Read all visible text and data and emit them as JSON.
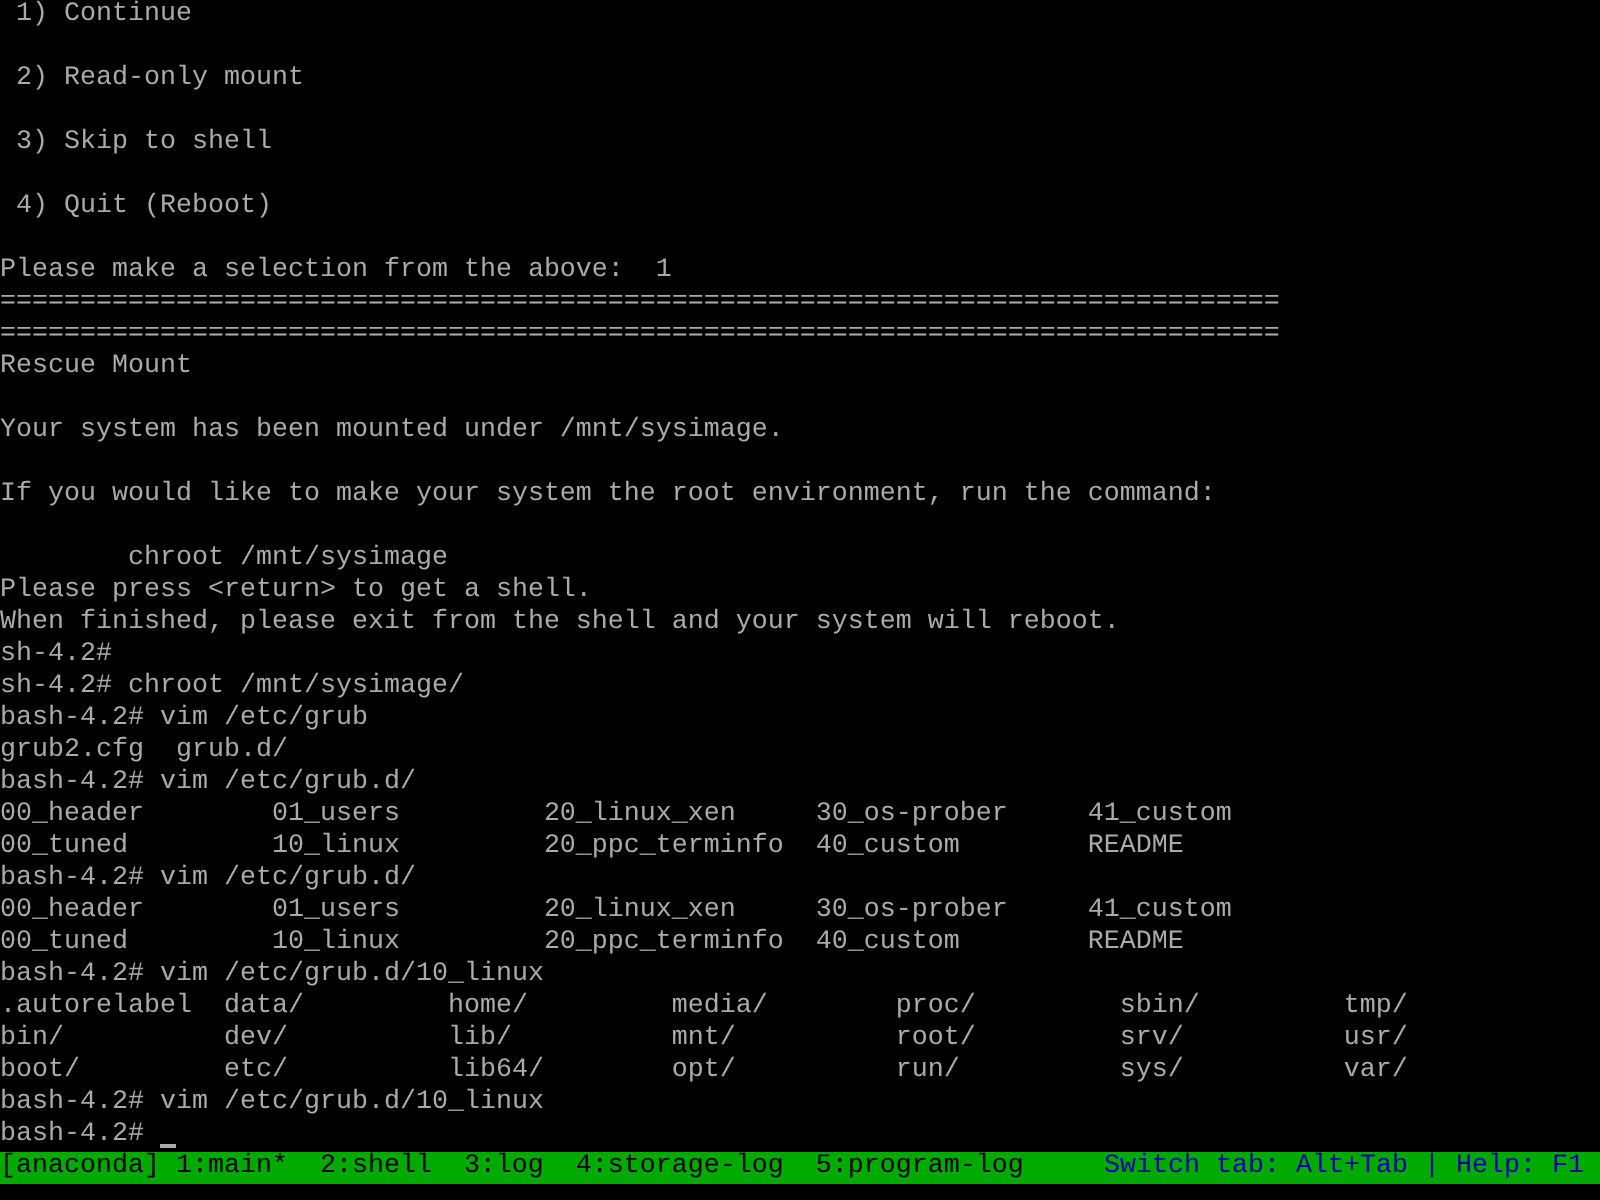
{
  "terminal": {
    "lines": [
      {
        "kind": "text",
        "text": " 1) Continue"
      },
      {
        "kind": "blank"
      },
      {
        "kind": "text",
        "text": " 2) Read-only mount"
      },
      {
        "kind": "blank"
      },
      {
        "kind": "text",
        "text": " 3) Skip to shell"
      },
      {
        "kind": "blank"
      },
      {
        "kind": "text",
        "text": " 4) Quit (Reboot)"
      },
      {
        "kind": "blank"
      },
      {
        "kind": "text",
        "text": "Please make a selection from the above:  1"
      },
      {
        "kind": "text",
        "text": "================================================================================"
      },
      {
        "kind": "text",
        "text": "================================================================================"
      },
      {
        "kind": "text",
        "text": "Rescue Mount"
      },
      {
        "kind": "blank"
      },
      {
        "kind": "text",
        "text": "Your system has been mounted under /mnt/sysimage."
      },
      {
        "kind": "blank"
      },
      {
        "kind": "text",
        "text": "If you would like to make your system the root environment, run the command:"
      },
      {
        "kind": "blank"
      },
      {
        "kind": "text",
        "text": "        chroot /mnt/sysimage"
      },
      {
        "kind": "text",
        "text": "Please press <return> to get a shell."
      },
      {
        "kind": "text",
        "text": "When finished, please exit from the shell and your system will reboot."
      },
      {
        "kind": "text",
        "text": "sh-4.2#"
      },
      {
        "kind": "text",
        "text": "sh-4.2# chroot /mnt/sysimage/"
      },
      {
        "kind": "text",
        "text": "bash-4.2# vim /etc/grub"
      },
      {
        "kind": "text",
        "text": "grub2.cfg  grub.d/"
      },
      {
        "kind": "text",
        "text": "bash-4.2# vim /etc/grub.d/"
      },
      {
        "kind": "text",
        "text": "00_header        01_users         20_linux_xen     30_os-prober     41_custom"
      },
      {
        "kind": "text",
        "text": "00_tuned         10_linux         20_ppc_terminfo  40_custom        README"
      },
      {
        "kind": "text",
        "text": "bash-4.2# vim /etc/grub.d/"
      },
      {
        "kind": "text",
        "text": "00_header        01_users         20_linux_xen     30_os-prober     41_custom"
      },
      {
        "kind": "text",
        "text": "00_tuned         10_linux         20_ppc_terminfo  40_custom        README"
      },
      {
        "kind": "text",
        "text": "bash-4.2# vim /etc/grub.d/10_linux"
      },
      {
        "kind": "text",
        "text": ".autorelabel  data/         home/         media/        proc/         sbin/         tmp/"
      },
      {
        "kind": "text",
        "text": "bin/          dev/          lib/          mnt/          root/         srv/          usr/"
      },
      {
        "kind": "text",
        "text": "boot/         etc/          lib64/        opt/          run/          sys/          var/"
      },
      {
        "kind": "text",
        "text": "bash-4.2# vim /etc/grub.d/10_linux"
      },
      {
        "kind": "prompt",
        "text": "bash-4.2#",
        "cursor": true
      }
    ]
  },
  "status_bar": {
    "session": "[anaconda]",
    "windows": [
      "1:main*",
      "2:shell",
      "3:log",
      "4:storage-log",
      "5:program-log"
    ],
    "hint": "Switch tab: Alt+Tab | Help: F1"
  }
}
